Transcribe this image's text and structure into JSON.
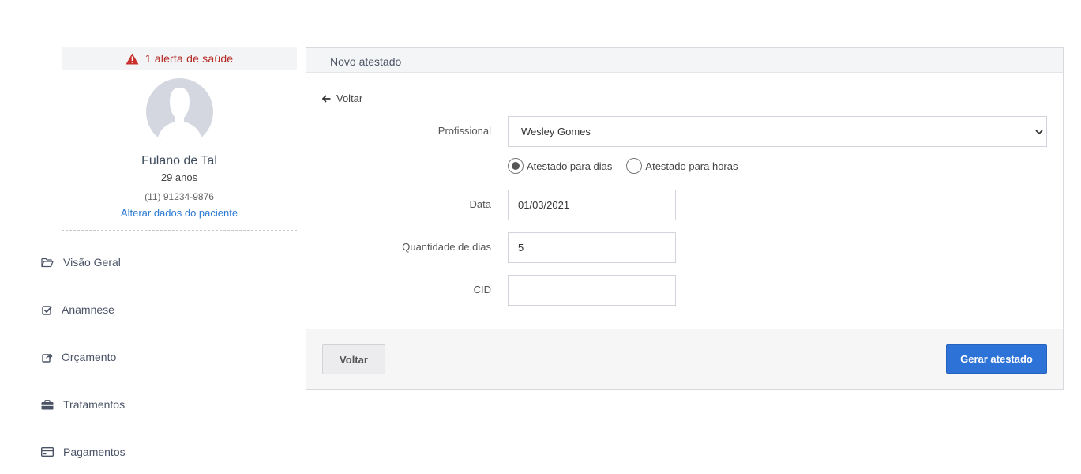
{
  "sidebar": {
    "health_alert": "1 alerta de saúde",
    "patient": {
      "name": "Fulano de Tal",
      "age": "29 anos",
      "phone": "(11) 91234-9876",
      "edit_link": "Alterar dados do paciente"
    },
    "nav": [
      {
        "label": "Visão Geral",
        "icon": "folder-open-icon"
      },
      {
        "label": "Anamnese",
        "icon": "checkbox-icon"
      },
      {
        "label": "Orçamento",
        "icon": "share-icon"
      },
      {
        "label": "Tratamentos",
        "icon": "briefcase-icon"
      },
      {
        "label": "Pagamentos",
        "icon": "credit-card-icon"
      }
    ]
  },
  "panel": {
    "title": "Novo atestado",
    "back_link": "Voltar",
    "form": {
      "profissional_label": "Profissional",
      "profissional_value": "Wesley Gomes",
      "radio_days": "Atestado para dias",
      "radio_hours": "Atestado para horas",
      "radio_selected": "days",
      "data_label": "Data",
      "data_value": "01/03/2021",
      "qtd_label": "Quantidade de dias",
      "qtd_value": "5",
      "cid_label": "CID",
      "cid_value": ""
    },
    "footer": {
      "back_button": "Voltar",
      "submit_button": "Gerar atestado"
    }
  },
  "colors": {
    "alert": "#b52a25",
    "link": "#2a7ad2",
    "primary": "#2d72d6"
  }
}
